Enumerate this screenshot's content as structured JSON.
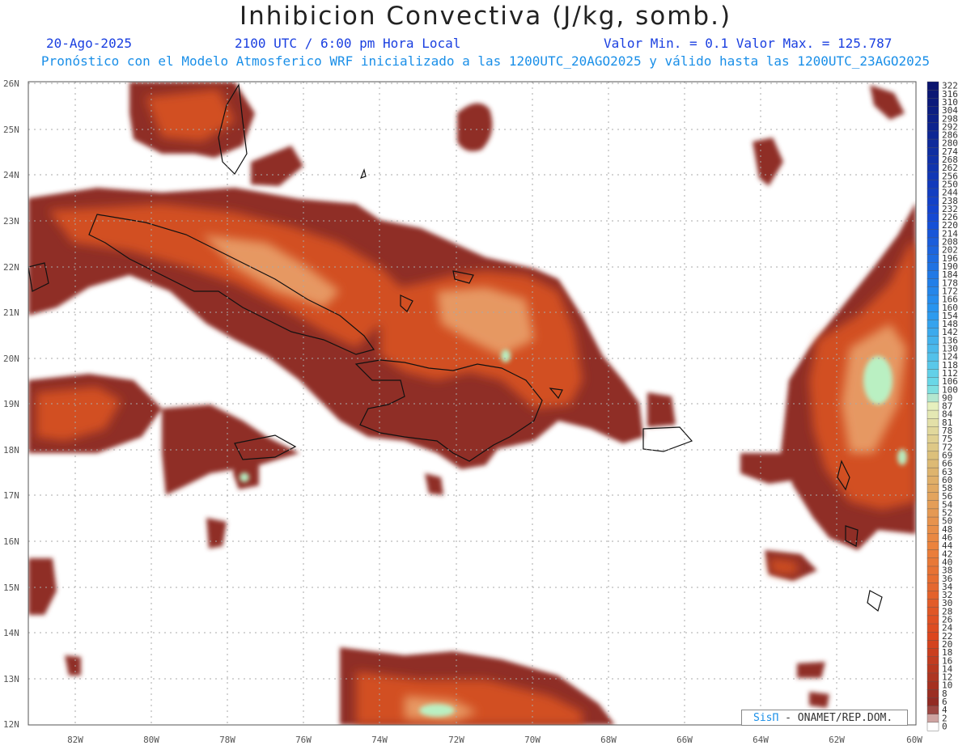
{
  "header": {
    "title": "Inhibicion Convectiva (J/kg, somb.)",
    "date": "20-Ago-2025",
    "time": "2100 UTC / 6:00 pm Hora Local",
    "range": "Valor Min. = 0.1  Valor Max. = 125.787",
    "subtitle": "Pronóstico con el Modelo Atmosferico WRF inicializado a las 1200UTC_20AGO2025 y válido hasta las  1200UTC_23AGO2025"
  },
  "map": {
    "lat_labels": [
      "26N",
      "25N",
      "24N",
      "23N",
      "22N",
      "21N",
      "20N",
      "19N",
      "18N",
      "17N",
      "16N",
      "15N",
      "14N",
      "13N",
      "12N"
    ],
    "lon_labels": [
      "82W",
      "80W",
      "78W",
      "76W",
      "74W",
      "72W",
      "70W",
      "68W",
      "66W",
      "64W",
      "62W",
      "60W"
    ]
  },
  "colorbar": {
    "labels": [
      "322",
      "316",
      "310",
      "304",
      "298",
      "292",
      "286",
      "280",
      "274",
      "268",
      "262",
      "256",
      "250",
      "244",
      "238",
      "232",
      "226",
      "220",
      "214",
      "208",
      "202",
      "196",
      "190",
      "184",
      "178",
      "172",
      "166",
      "160",
      "154",
      "148",
      "142",
      "136",
      "130",
      "124",
      "118",
      "112",
      "106",
      "100",
      "90",
      "87",
      "84",
      "81",
      "78",
      "75",
      "72",
      "69",
      "66",
      "63",
      "60",
      "58",
      "56",
      "54",
      "52",
      "50",
      "48",
      "46",
      "44",
      "42",
      "40",
      "38",
      "36",
      "34",
      "32",
      "30",
      "28",
      "26",
      "24",
      "22",
      "20",
      "18",
      "16",
      "14",
      "12",
      "10",
      "8",
      "6",
      "4",
      "2",
      "0"
    ]
  },
  "credit": {
    "brand": "SisΠ",
    "text": " - ONAMET/REP.DOM."
  }
}
